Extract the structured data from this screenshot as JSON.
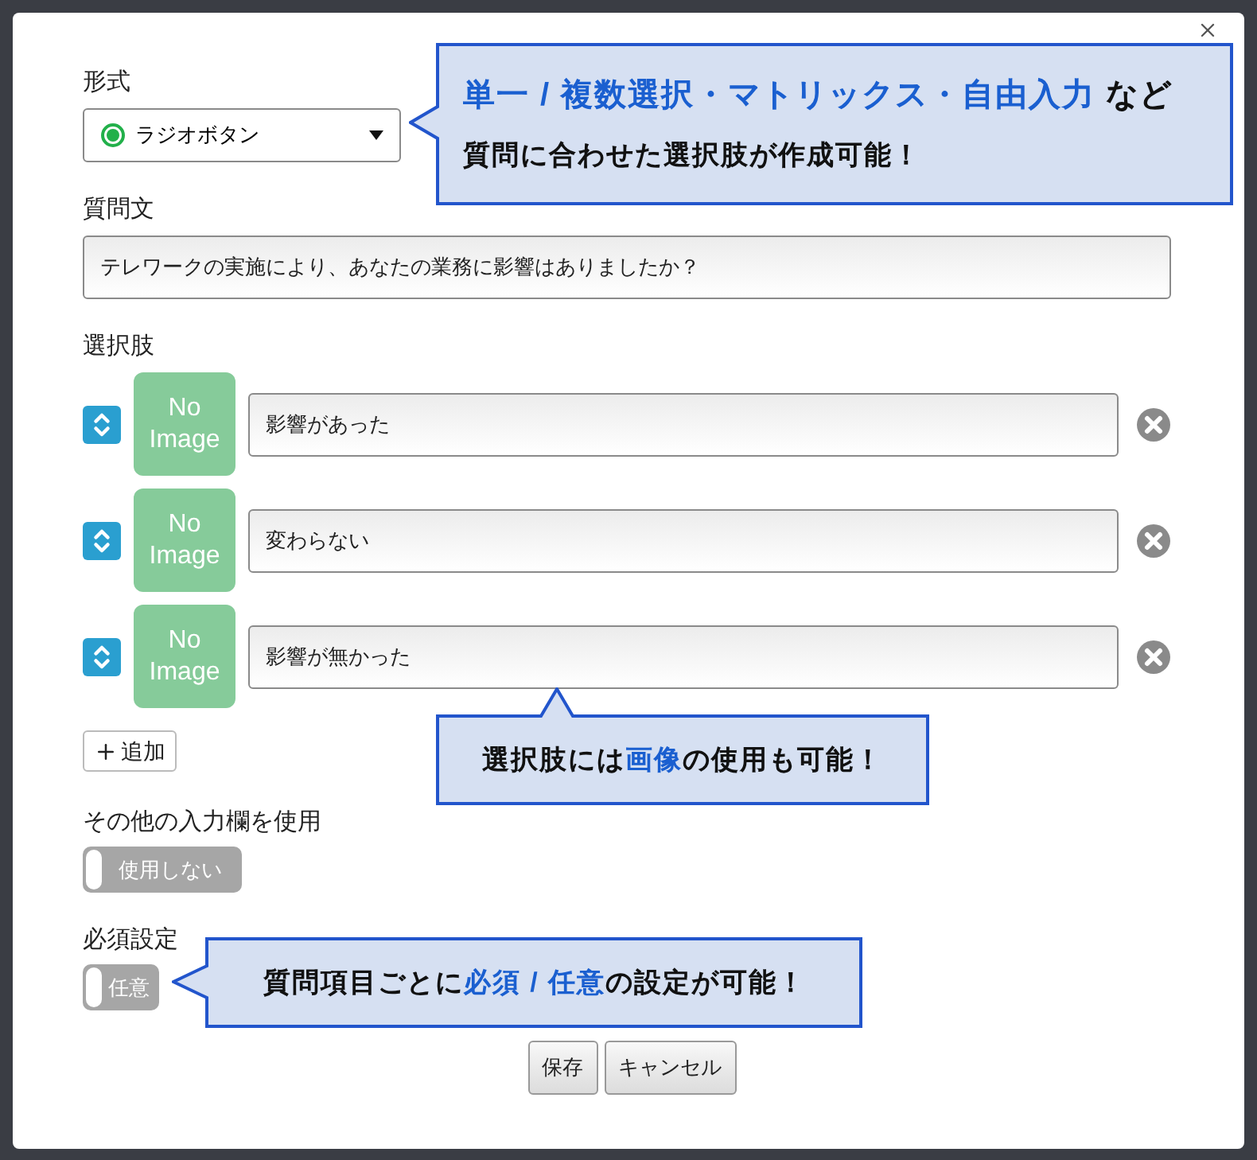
{
  "format": {
    "label": "形式",
    "value": "ラジオボタン"
  },
  "question": {
    "label": "質問文",
    "value": "テレワークの実施により、あなたの業務に影響はありましたか？"
  },
  "choices": {
    "label": "選択肢",
    "items": [
      {
        "image_text": "No Image",
        "value": "影響があった"
      },
      {
        "image_text": "No Image",
        "value": "変わらない"
      },
      {
        "image_text": "No Image",
        "value": "影響が無かった"
      }
    ],
    "add_button": "追加"
  },
  "other_input": {
    "label": "その他の入力欄を使用",
    "toggle": {
      "on": false,
      "text": "使用しない"
    }
  },
  "required": {
    "label": "必須設定",
    "toggle": {
      "on": false,
      "text": "任意"
    }
  },
  "buttons": [
    "保存",
    "キャンセル"
  ],
  "callouts": [
    {
      "lines": [
        [
          {
            "text": "単一 / 複数選択・マトリックス・自由入力",
            "highlight": true
          },
          {
            "text": " など",
            "highlight": false
          }
        ],
        [
          {
            "text": "質問に合わせた選択肢が作成可能！",
            "highlight": false
          }
        ]
      ]
    },
    {
      "lines": [
        [
          {
            "text": "選択肢には",
            "highlight": false
          },
          {
            "text": "画像",
            "highlight": true
          },
          {
            "text": "の使用も可能！",
            "highlight": false
          }
        ]
      ]
    },
    {
      "lines": [
        [
          {
            "text": "質問項目ごとに",
            "highlight": false
          },
          {
            "text": "必須 / 任意",
            "highlight": true
          },
          {
            "text": "の設定が可能！",
            "highlight": false
          }
        ]
      ]
    }
  ]
}
